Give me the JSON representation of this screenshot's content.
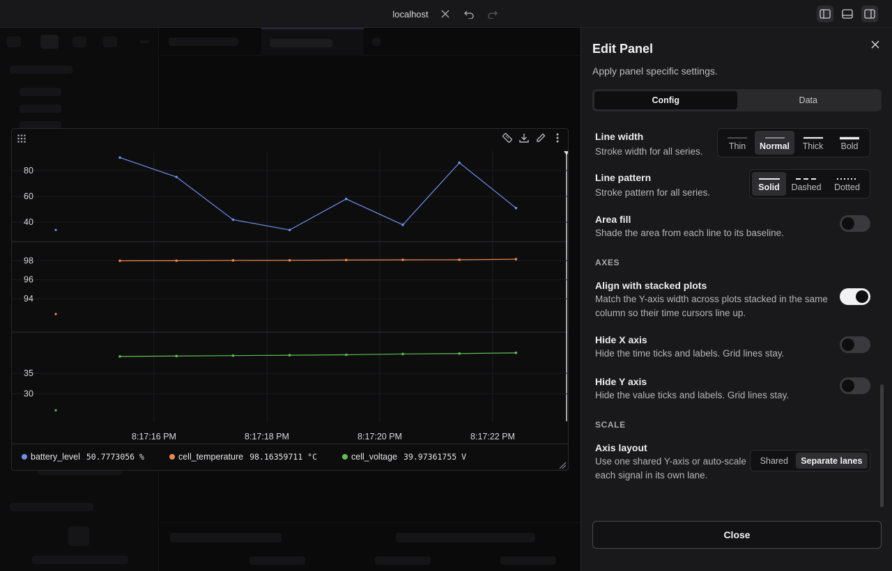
{
  "window": {
    "title": "localhost",
    "layout_buttons": [
      "left-panel-icon",
      "bottom-panel-icon",
      "right-panel-icon"
    ]
  },
  "plot": {
    "timestamps": [
      "8:17:16 PM",
      "8:17:18 PM",
      "8:17:20 PM",
      "8:17:22 PM"
    ],
    "colors": {
      "battery_level": "#6f8fe8",
      "cell_temperature": "#f08a4b",
      "cell_voltage": "#5fbf52"
    },
    "legend": [
      {
        "name": "battery_level",
        "value": "50.7773056 %",
        "color": "#6f8fe8"
      },
      {
        "name": "cell_temperature",
        "value": "98.16359711 °C",
        "color": "#f08a4b"
      },
      {
        "name": "cell_voltage",
        "value": "39.97361755 V",
        "color": "#5fbf52"
      }
    ]
  },
  "chart_data": {
    "type": "line",
    "x": [
      "8:17:15",
      "8:17:16",
      "8:17:17",
      "8:17:18",
      "8:17:19",
      "8:17:20",
      "8:17:21",
      "8:17:22"
    ],
    "xticks": [
      "8:17:16 PM",
      "8:17:18 PM",
      "8:17:20 PM",
      "8:17:22 PM"
    ],
    "lanes": [
      {
        "name": "battery_level",
        "color": "#6f8fe8",
        "ylim": [
          25,
          95
        ],
        "yticks": [
          40,
          60,
          80
        ],
        "values": [
          90,
          75,
          42,
          34,
          58,
          38,
          86,
          51
        ],
        "extra_point": 34
      },
      {
        "name": "cell_temperature",
        "color": "#f08a4b",
        "ylim": [
          90.5,
          100
        ],
        "yticks": [
          94,
          96,
          98
        ],
        "values": [
          97.99,
          98.0,
          98.03,
          98.04,
          98.07,
          98.09,
          98.1,
          98.16
        ],
        "extra_point": 92.4
      },
      {
        "name": "cell_voltage",
        "color": "#5fbf52",
        "ylim": [
          23,
          45
        ],
        "yticks": [
          30,
          35
        ],
        "values": [
          39.1,
          39.2,
          39.3,
          39.4,
          39.5,
          39.7,
          39.8,
          39.97
        ],
        "extra_point": 26
      }
    ]
  },
  "edit_panel": {
    "title": "Edit Panel",
    "subtitle": "Apply panel specific settings.",
    "tabs": [
      {
        "label": "Config",
        "active": true
      },
      {
        "label": "Data",
        "active": false
      }
    ],
    "line_width": {
      "title": "Line width",
      "desc": "Stroke width for all series.",
      "options": [
        "Thin",
        "Normal",
        "Thick",
        "Bold"
      ],
      "selected": "Normal"
    },
    "line_pattern": {
      "title": "Line pattern",
      "desc": "Stroke pattern for all series.",
      "options": [
        "Solid",
        "Dashed",
        "Dotted"
      ],
      "selected": "Solid"
    },
    "area_fill": {
      "title": "Area fill",
      "desc": "Shade the area from each line to its baseline.",
      "on": false
    },
    "axes_label": "AXES",
    "align_stacked": {
      "title": "Align with stacked plots",
      "desc": "Match the Y-axis width across plots stacked in the same column so their time cursors line up.",
      "on": true
    },
    "hide_x": {
      "title": "Hide X axis",
      "desc": "Hide the time ticks and labels. Grid lines stay.",
      "on": false
    },
    "hide_y": {
      "title": "Hide Y axis",
      "desc": "Hide the value ticks and labels. Grid lines stay.",
      "on": false
    },
    "scale_label": "SCALE",
    "axis_layout": {
      "title": "Axis layout",
      "desc": "Use one shared Y-axis or auto-scale each signal in its own lane.",
      "options": [
        "Shared",
        "Separate lanes"
      ],
      "selected": "Separate lanes"
    },
    "close_label": "Close"
  }
}
